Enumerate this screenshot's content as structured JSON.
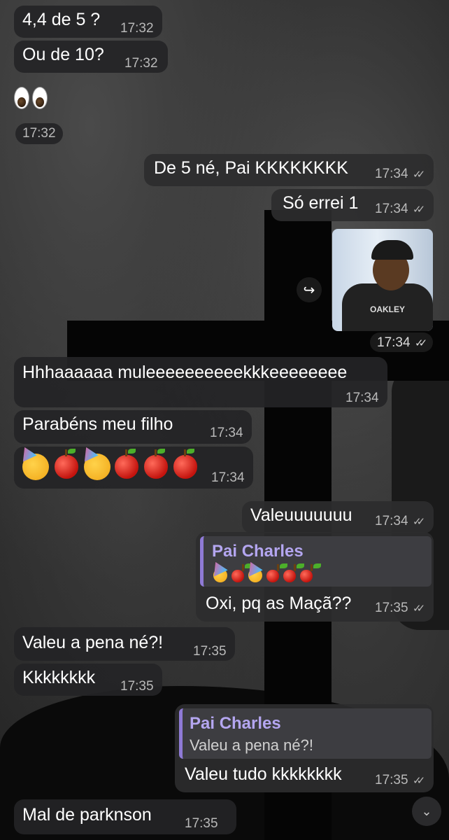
{
  "messages": [
    {
      "text": "4,4 de 5 ?",
      "time": "17:32"
    },
    {
      "text": "Ou de 10?",
      "time": "17:32"
    },
    {
      "emoji": "eyes",
      "time": "17:32"
    },
    {
      "text": "De 5 né, Pai KKKKKKKK",
      "time": "17:34",
      "status": "read"
    },
    {
      "text": "Só errei 1",
      "time": "17:34",
      "status": "read"
    },
    {
      "image": "forwarded-photo",
      "time": "17:34",
      "status": "read"
    },
    {
      "text": "Hhhaaaaaa muleeeeeeeeeekkkeeeeeeee",
      "time": "17:34"
    },
    {
      "text": "Parabéns meu filho",
      "time": "17:34"
    },
    {
      "emoji_sequence": [
        "partying-face",
        "red-apple",
        "partying-face",
        "red-apple",
        "red-apple",
        "red-apple"
      ],
      "time": "17:34"
    },
    {
      "text": "Valeuuuuuuu",
      "time": "17:34",
      "status": "read"
    },
    {
      "reply_name": "Pai Charles",
      "reply_emoji": [
        "partying-face",
        "red-apple",
        "partying-face",
        "red-apple",
        "red-apple",
        "red-apple"
      ],
      "text": "Oxi, pq as Maçã??",
      "time": "17:35",
      "status": "read"
    },
    {
      "text": "Valeu a pena né?!",
      "time": "17:35"
    },
    {
      "text": "Kkkkkkkk",
      "time": "17:35"
    },
    {
      "reply_name": "Pai Charles",
      "reply_text": "Valeu a pena né?!",
      "text": "Valeu tudo kkkkkkkk",
      "time": "17:35",
      "status": "read"
    },
    {
      "text": "Mal de parknson",
      "time": "17:35"
    }
  ],
  "ticks_glyph": "✓✓",
  "icons": {
    "forward": "forward-icon",
    "scroll_down": "scroll-down-icon"
  },
  "colors": {
    "reply_accent": "#8f7ad6",
    "reply_name": "#b4a6f0",
    "bubble_in": "#242426",
    "bubble_out": "#2c2c2e"
  }
}
